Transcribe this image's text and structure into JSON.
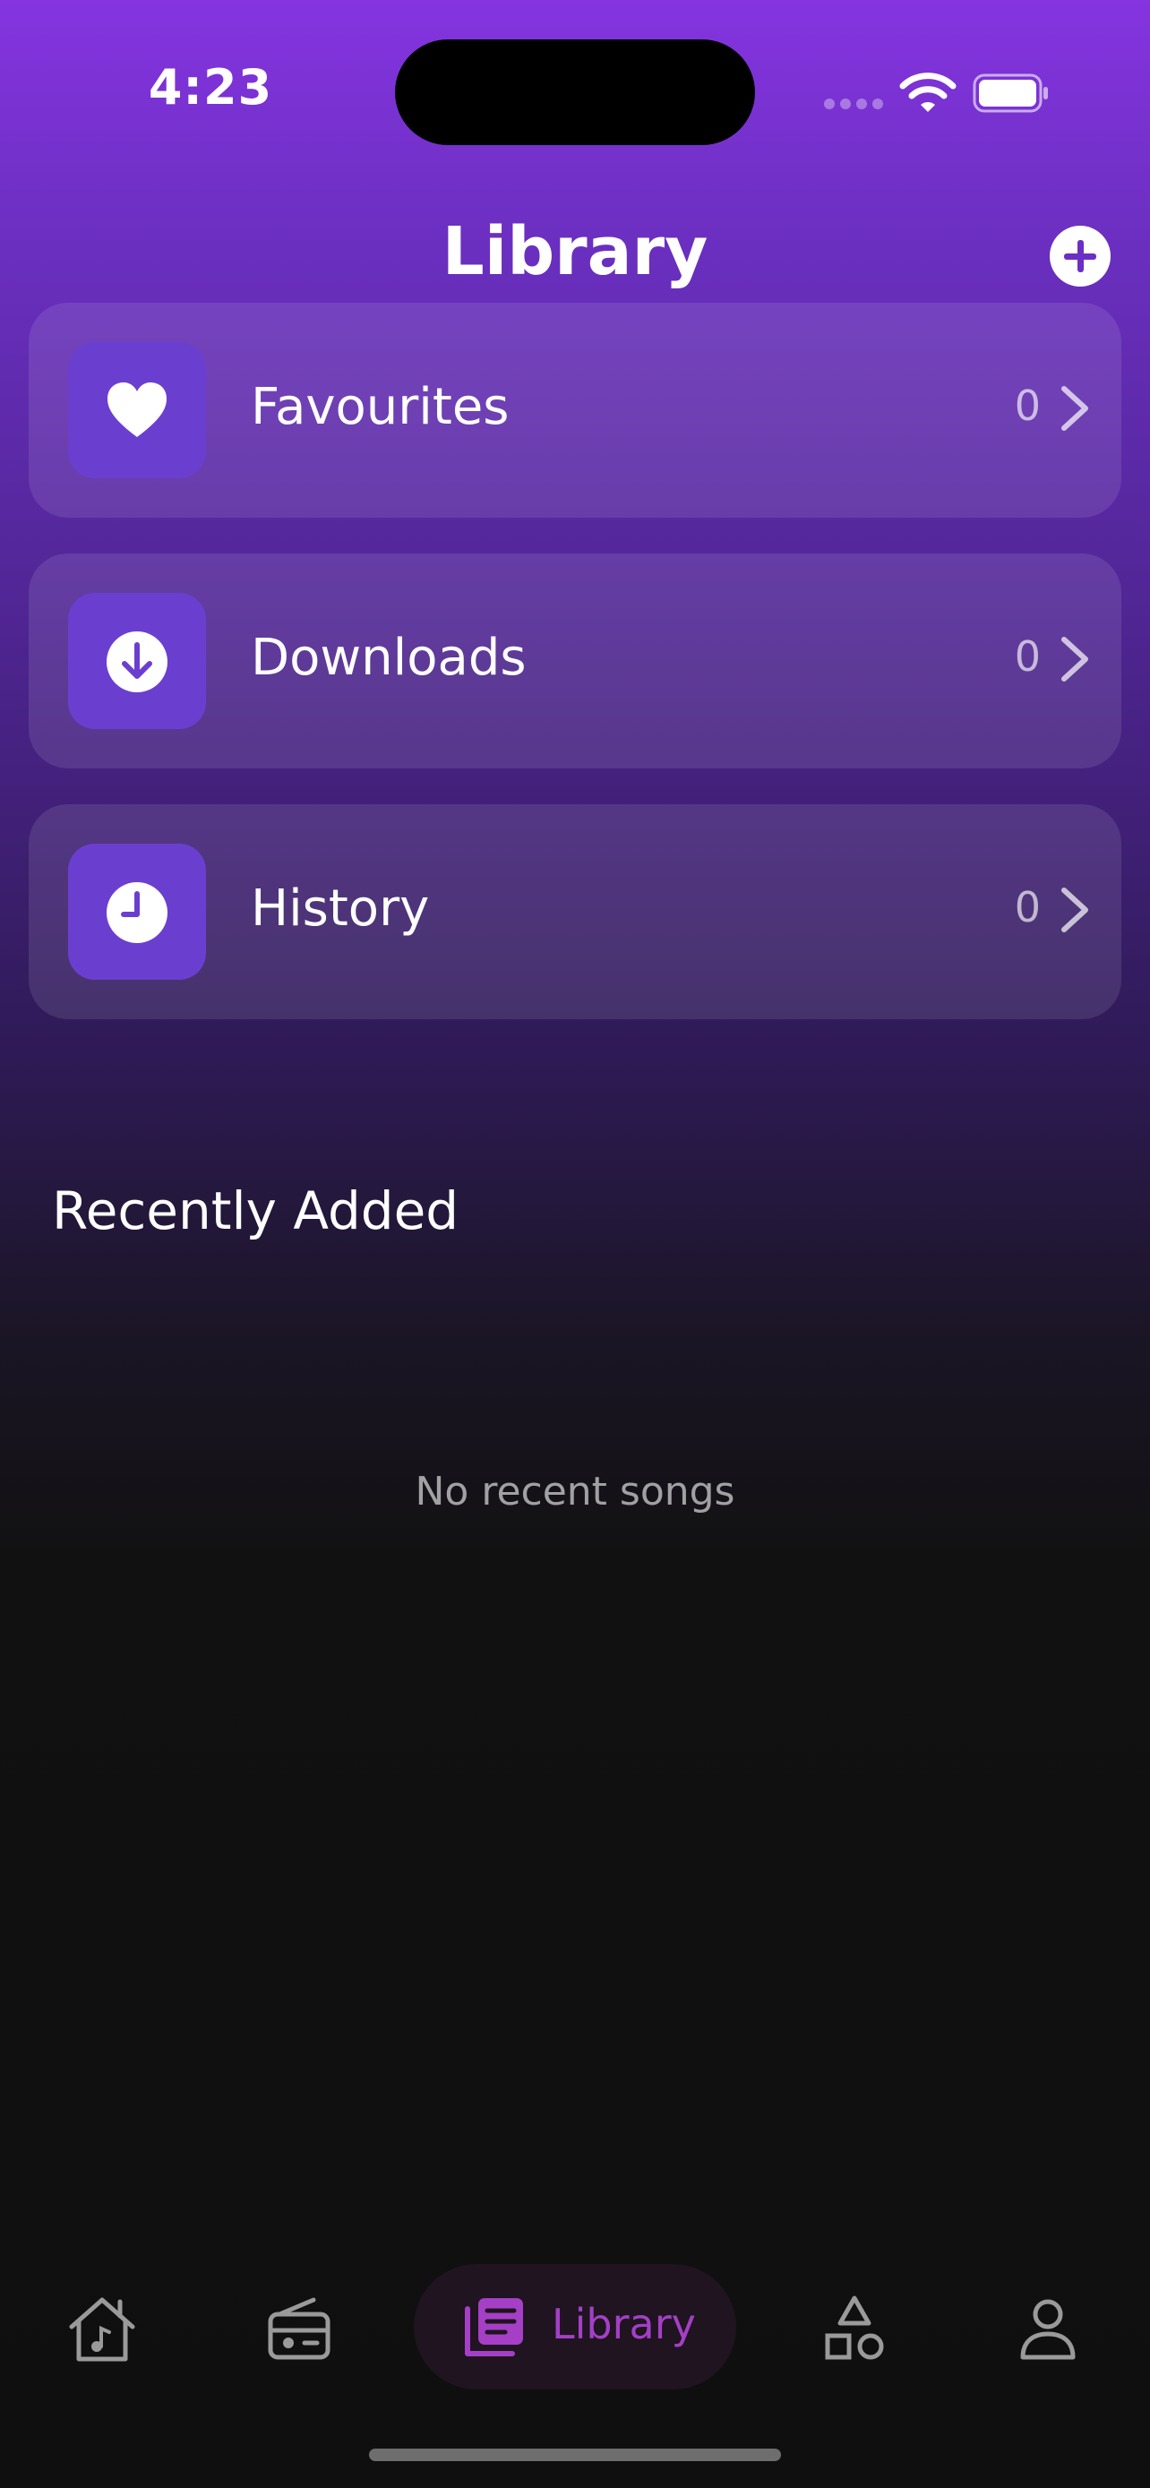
{
  "status_bar": {
    "time": "4:23"
  },
  "header": {
    "title": "Library"
  },
  "library": {
    "items": [
      {
        "label": "Favourites",
        "count": "0",
        "icon": "heart-icon"
      },
      {
        "label": "Downloads",
        "count": "0",
        "icon": "download-icon"
      },
      {
        "label": "History",
        "count": "0",
        "icon": "clock-icon"
      }
    ]
  },
  "recent": {
    "title": "Recently Added",
    "empty_text": "No recent songs"
  },
  "bottom_nav": {
    "items": [
      {
        "icon": "home-music-icon"
      },
      {
        "icon": "radio-icon"
      },
      {
        "label": "Library",
        "icon": "library-icon",
        "active": true
      },
      {
        "icon": "shapes-icon"
      },
      {
        "icon": "profile-icon"
      }
    ]
  },
  "colors": {
    "accent": "#a43fc6",
    "icon_tile": "#6a3fd0",
    "gradient_top": "#8534e0",
    "background": "#0f0f0f"
  }
}
